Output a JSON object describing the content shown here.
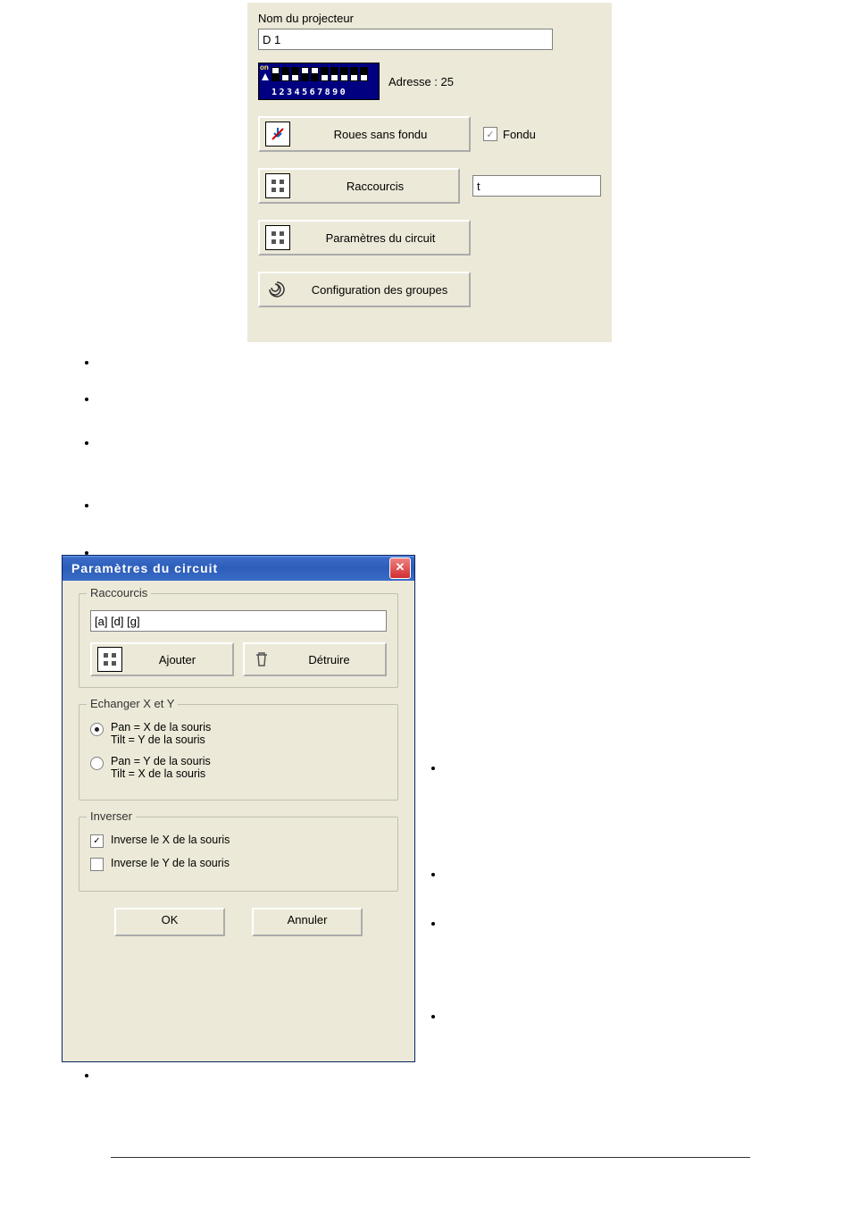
{
  "panel1": {
    "name_label": "Nom du projecteur",
    "name_value": "D 1",
    "dip_numbers": "1234567890",
    "dip_on": "on",
    "dip_states": [
      "up",
      "down",
      "down",
      "up",
      "up",
      "down",
      "down",
      "down",
      "down",
      "down"
    ],
    "address_label": "Adresse : 25",
    "btn_roues": "Roues sans fondu",
    "chk_fondu_label": "Fondu",
    "chk_fondu_checked": true,
    "btn_raccourcis": "Raccourcis",
    "raccourcis_value": "t",
    "btn_params": "Paramètres du circuit",
    "btn_groups": "Configuration des groupes"
  },
  "bullets_top": {
    "b1": "",
    "b2": "",
    "b3": "",
    "b4": "",
    "b5": ""
  },
  "dialog": {
    "title": "Paramètres du circuit",
    "grp_raccourcis": {
      "legend": "Raccourcis",
      "value": "[a] [d] [g]",
      "btn_add": "Ajouter",
      "btn_del": "Détruire"
    },
    "grp_echanger": {
      "legend": "Echanger X et Y",
      "opt1": "Pan = X de la souris\nTilt = Y de la souris",
      "opt2": "Pan = Y de la souris\nTilt = X de la souris",
      "selected": 1
    },
    "grp_inverser": {
      "legend": "Inverser",
      "chk_x": "Inverse le X de la souris",
      "chk_x_checked": true,
      "chk_y": "Inverse le Y de la souris",
      "chk_y_checked": false
    },
    "btn_ok": "OK",
    "btn_cancel": "Annuler"
  },
  "side_bullets": {
    "s1": "",
    "s2": "",
    "s3": "",
    "s4": ""
  },
  "bottom_bullet": ""
}
